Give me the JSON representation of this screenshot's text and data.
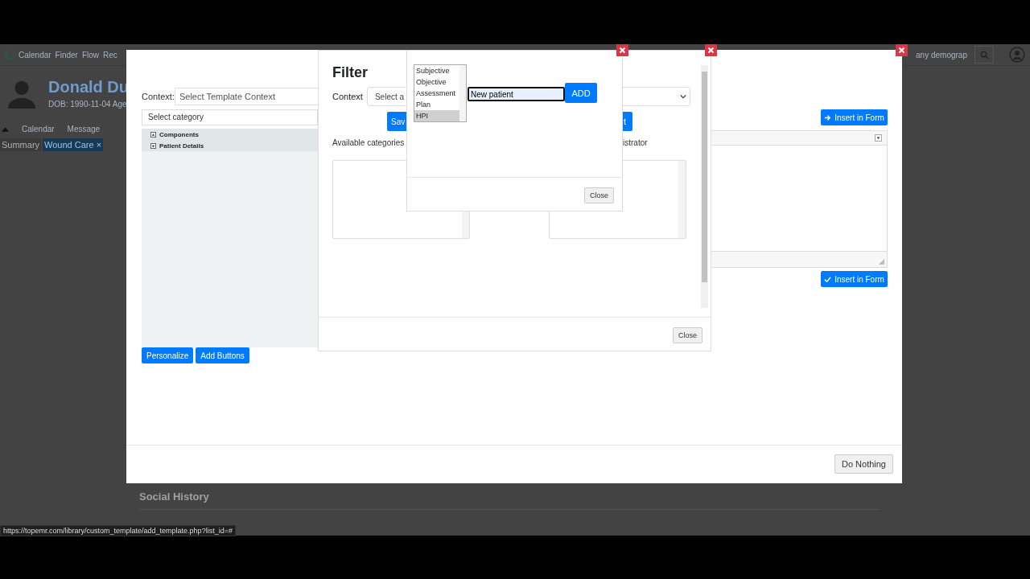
{
  "background_app": {
    "nav_items": [
      {
        "label": "Calendar"
      },
      {
        "label": "Finder"
      },
      {
        "label": "Flow"
      },
      {
        "label": "Rec"
      }
    ],
    "search": {
      "placeholder": "any demograp"
    },
    "patient": {
      "name": "Donald Du",
      "dob": "DOB: 1990-11-04 Age"
    },
    "toolbar_items": [
      {
        "label": "Calendar"
      },
      {
        "label": "Message"
      }
    ],
    "tabs": [
      {
        "label": "Summary",
        "selected": false
      },
      {
        "label": "Wound Care ×",
        "selected": true
      }
    ],
    "section_title": "Social History"
  },
  "template_dialog": {
    "context_label": "Context:",
    "context_field": {
      "placeholder": "Select Template Context"
    },
    "category_select": "Select category",
    "tree": [
      {
        "label": "Components",
        "expanded": false
      },
      {
        "label": "Patient Details",
        "expanded": true
      }
    ],
    "buttons": [
      {
        "label": "Personalize"
      },
      {
        "label": "Add Buttons"
      }
    ],
    "insert_buttons": [
      {
        "label": "Insert in Form",
        "kind": "arrow"
      },
      {
        "label": "Insert in Form",
        "kind": "check"
      }
    ],
    "footer_button": "Do Nothing"
  },
  "filter_dialog": {
    "title": "Filter",
    "context_label": "Context",
    "context_select": "Select a",
    "buttons": [
      {
        "label": "Sav"
      },
      {
        "label": "t"
      }
    ],
    "available_label": "Available categories",
    "assigned_label": "istrator",
    "footer_button": "Close"
  },
  "add_category_dialog": {
    "options": [
      {
        "label": "Subjective",
        "selected": false
      },
      {
        "label": "Objective",
        "selected": false
      },
      {
        "label": "Assessment",
        "selected": false
      },
      {
        "label": "Plan",
        "selected": false
      },
      {
        "label": "HPI",
        "selected": true
      }
    ],
    "input": {
      "value": "New patient"
    },
    "add_button": "ADD",
    "footer_button": "Close"
  },
  "status_bar": {
    "url": "https://topemr.com/library/custom_template/add_template.php?list_id=#"
  }
}
